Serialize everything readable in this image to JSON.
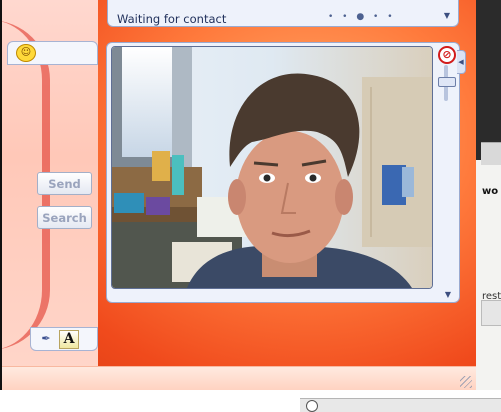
{
  "status": {
    "text": "Waiting for contact",
    "dots": "• • ● • •"
  },
  "compose": {
    "send_label": "Send",
    "search_label": "Search"
  },
  "font_bar": {
    "font_button_label": "A"
  },
  "webcam": {
    "block_icon": "block-icon"
  },
  "background_app": {
    "text1": "wo",
    "text2": "rest"
  },
  "colors": {
    "accent": "#f04a1c",
    "panel": "#eef2fb",
    "border": "#9aaad0"
  }
}
